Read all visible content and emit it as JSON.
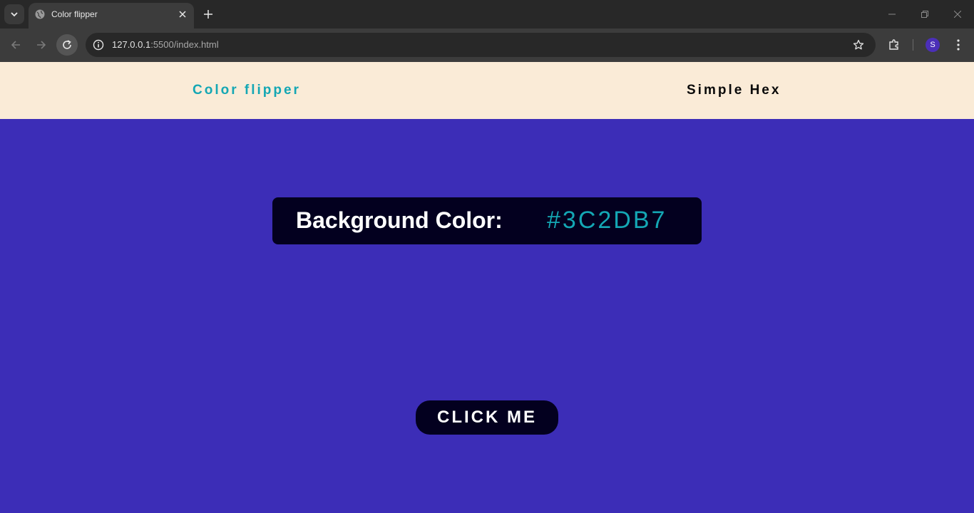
{
  "browser": {
    "tab_title": "Color flipper",
    "url_host": "127.0.0.1",
    "url_rest": ":5500/index.html",
    "profile_initial": "S"
  },
  "navbar": {
    "brand": "Color flipper",
    "link": "Simple Hex"
  },
  "main": {
    "label": "Background Color:",
    "value": "#3C2DB7",
    "button_label": "CLICK ME"
  },
  "colors": {
    "page_background": "#3c2db7",
    "navbar_background": "#faebd7",
    "accent": "#14a7b4",
    "dark": "#03001f"
  }
}
